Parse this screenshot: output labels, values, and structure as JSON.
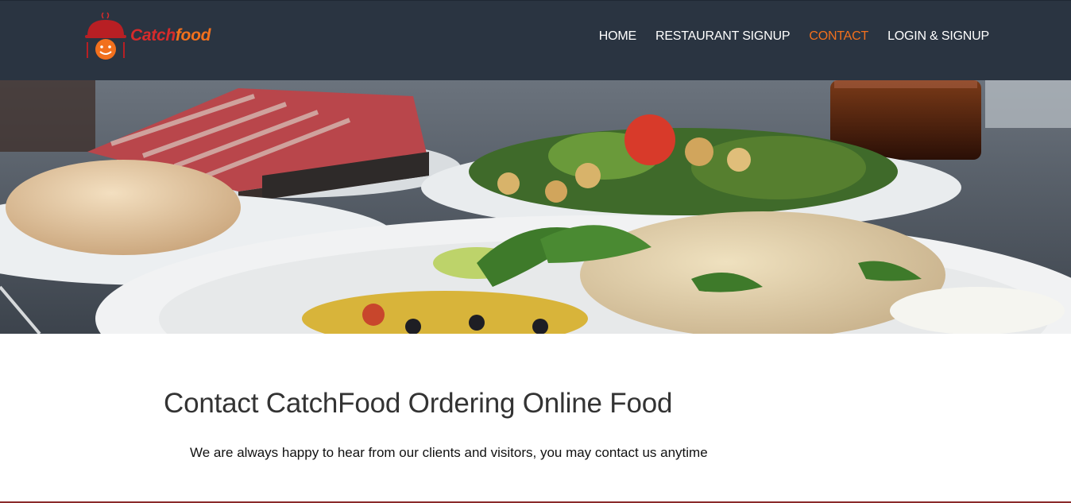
{
  "header": {
    "logo": {
      "text_catch": "Catch",
      "text_food": "food",
      "icon": "chef-hat-plate-icon"
    },
    "nav": [
      {
        "label": "HOME",
        "active": false
      },
      {
        "label": "RESTAURANT SIGNUP",
        "active": false
      },
      {
        "label": "CONTACT",
        "active": true
      },
      {
        "label": "LOGIN & SIGNUP",
        "active": false
      }
    ]
  },
  "hero": {
    "image": "food-table-photo"
  },
  "main": {
    "title": "Contact CatchFood Ordering Online Food",
    "description": "We are always happy to hear from our clients and visitors, you may contact us anytime"
  },
  "colors": {
    "header_bg": "#2a3441",
    "accent": "#f2701d",
    "brand_red": "#d62b2b"
  }
}
